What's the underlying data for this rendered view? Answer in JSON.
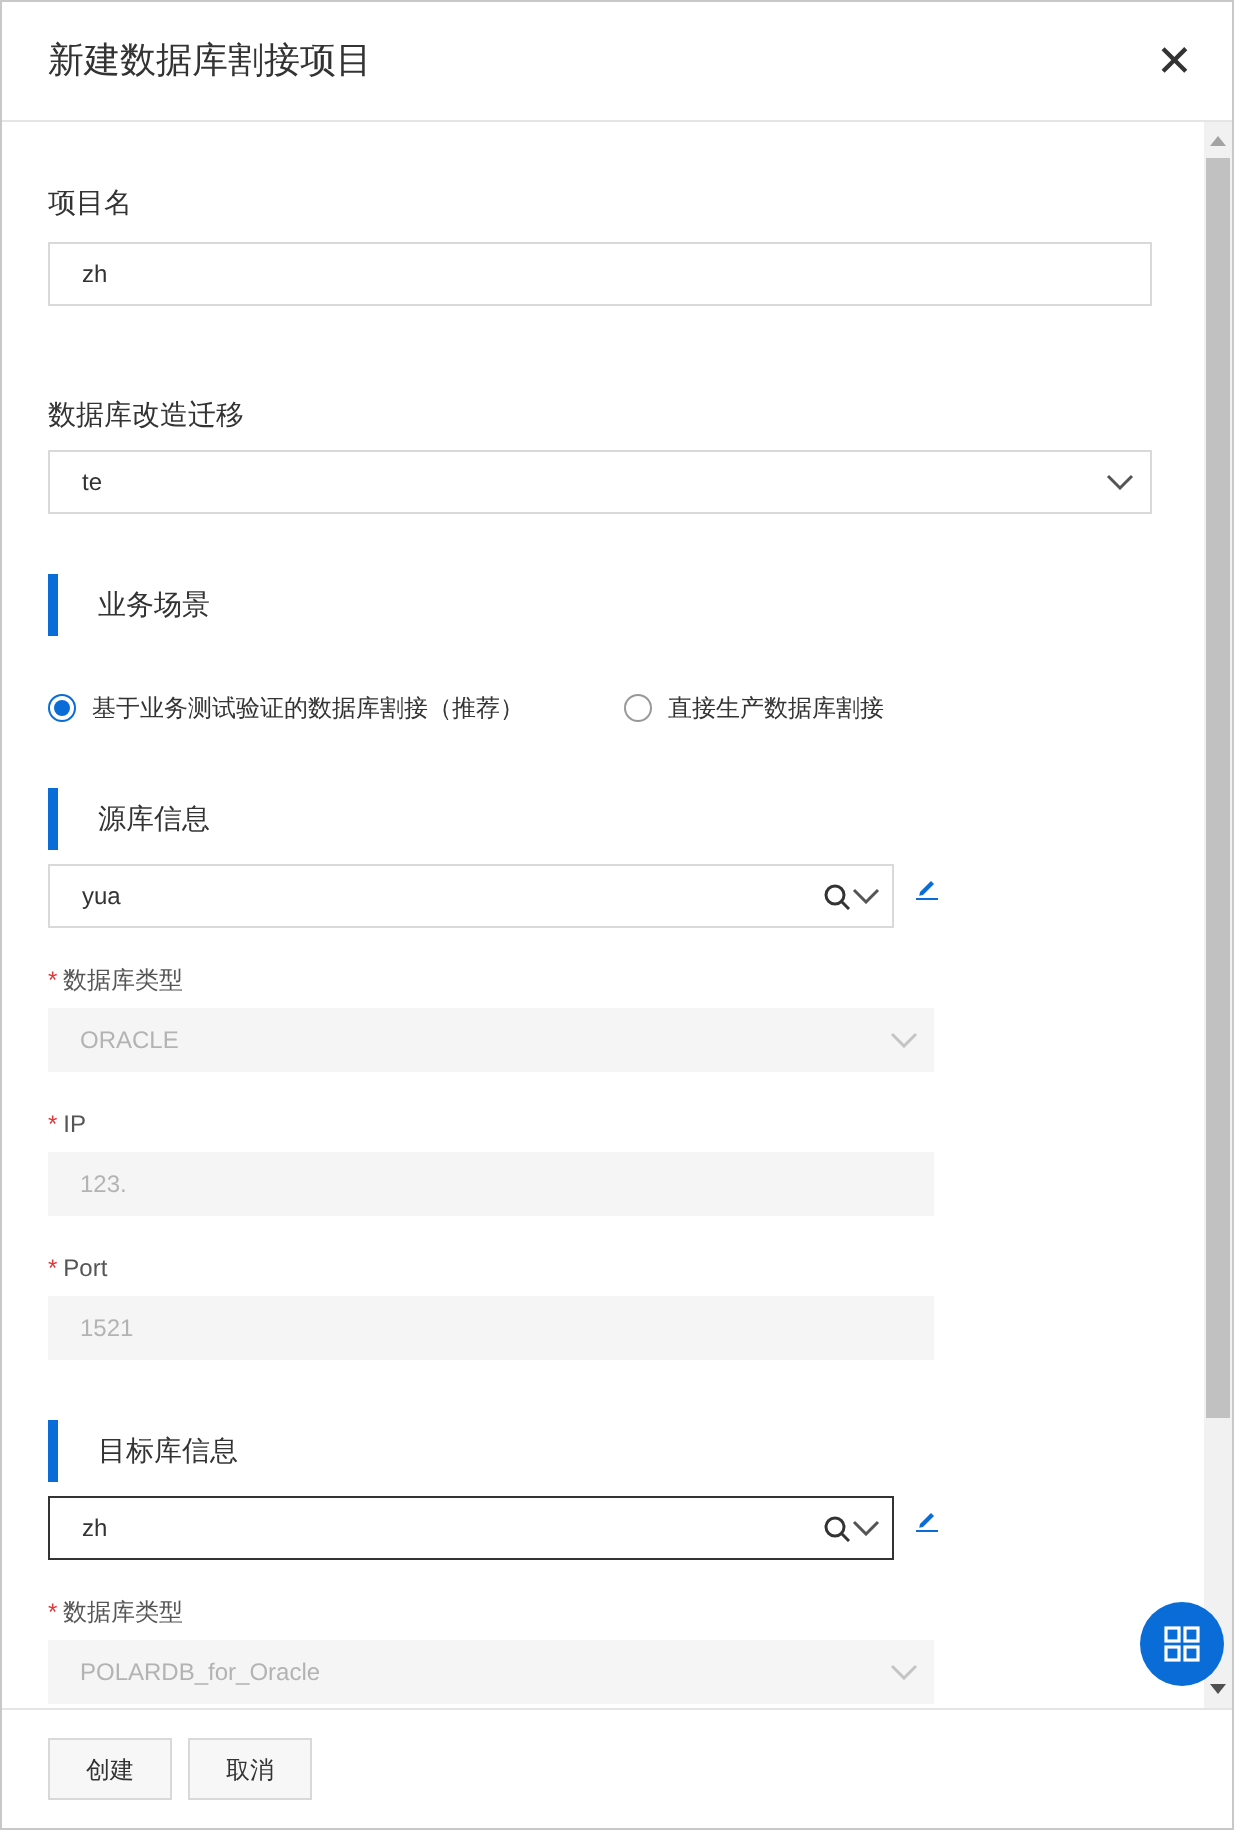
{
  "dialog": {
    "title": "新建数据库割接项目",
    "close": "✕"
  },
  "form": [
    {
      "kind": "label",
      "text": "项目名"
    },
    {
      "kind": "input",
      "value": "zh"
    },
    {
      "kind": "label",
      "text": "数据库改造迁移"
    },
    {
      "kind": "select",
      "value": "te"
    },
    {
      "kind": "section",
      "text": "业务场景"
    },
    {
      "kind": "radios",
      "options": [
        {
          "label": "基于业务测试验证的数据库割接（推荐）",
          "selected": true
        },
        {
          "label": "直接生产数据库割接",
          "selected": false
        }
      ]
    },
    {
      "kind": "section",
      "text": "源库信息"
    },
    {
      "kind": "search_select",
      "value": "yua",
      "focused": false
    },
    {
      "kind": "sub_label",
      "text": "数据库类型",
      "required_mark": "*"
    },
    {
      "kind": "disabled_select",
      "value": "ORACLE"
    },
    {
      "kind": "sub_label",
      "text": "IP",
      "required_mark": "*"
    },
    {
      "kind": "disabled_input",
      "value": "123."
    },
    {
      "kind": "sub_label",
      "text": "Port",
      "required_mark": "*"
    },
    {
      "kind": "disabled_input",
      "value": "1521"
    },
    {
      "kind": "section",
      "text": "目标库信息"
    },
    {
      "kind": "search_select",
      "value": "zh",
      "focused": true
    },
    {
      "kind": "sub_label",
      "text": "数据库类型",
      "required_mark": "*"
    },
    {
      "kind": "disabled_select",
      "value": "POLARDB_for_Oracle"
    }
  ],
  "footer": {
    "buttons": [
      "创建",
      "取消"
    ]
  }
}
